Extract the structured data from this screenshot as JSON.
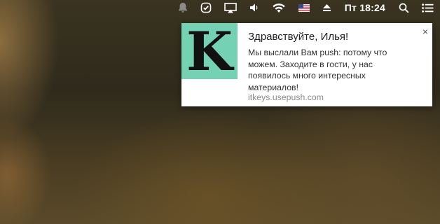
{
  "menubar": {
    "icons": [
      "bell-icon",
      "check-shield-icon",
      "airplay-icon",
      "volume-icon",
      "wifi-icon",
      "us-flag-icon",
      "eject-icon",
      "search-icon",
      "list-icon"
    ],
    "clock": "Пт 18:24"
  },
  "notification": {
    "logo_letter": "K",
    "logo_color": "#74d1b4",
    "title": "Здравствуйте, Илья!",
    "body": "Мы выслали Вам push: потому что можем. Заходите в гости, у нас появилось много интересных материалов!",
    "source": "itkeys.usepush.com",
    "close_label": "×"
  }
}
